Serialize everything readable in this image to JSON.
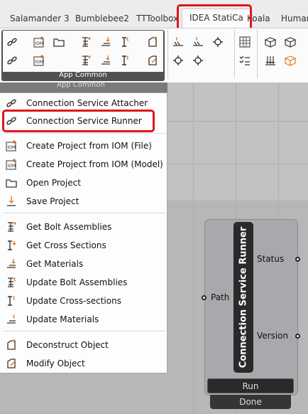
{
  "tabs": [
    "Salamander 3",
    "Bumblebee2",
    "TTToolbox",
    "IDEA StatiCa",
    "Koala",
    "Human"
  ],
  "active_tab": "IDEA StatiCa",
  "ribbon": {
    "group_title": "App Common",
    "group_title_ghost": "App Common"
  },
  "menu": {
    "items": [
      {
        "label": "Connection Service Attacher",
        "icon": "chain-link-icon"
      },
      {
        "label": "Connection Service Runner",
        "icon": "chain-link-run-icon"
      },
      {
        "label": "Create Project from IOM (File)",
        "icon": "iom-file-icon"
      },
      {
        "label": "Create Project from IOM (Model)",
        "icon": "iom-model-icon"
      },
      {
        "label": "Open Project",
        "icon": "folder-icon"
      },
      {
        "label": "Save Project",
        "icon": "save-arrow-icon"
      },
      {
        "label": "Get Bolt Assemblies",
        "icon": "bolt-assembly-icon"
      },
      {
        "label": "Get Cross Sections",
        "icon": "cross-section-icon"
      },
      {
        "label": "Get Materials",
        "icon": "material-icon"
      },
      {
        "label": "Update Bolt Assemblies",
        "icon": "bolt-update-icon"
      },
      {
        "label": "Update Cross-sections",
        "icon": "cross-section-update-icon"
      },
      {
        "label": "Update Materials",
        "icon": "material-update-icon"
      },
      {
        "label": "Deconstruct Object",
        "icon": "deconstruct-icon"
      },
      {
        "label": "Modify Object",
        "icon": "modify-icon"
      }
    ]
  },
  "node": {
    "title": "Connection Service Runner",
    "input": "Path",
    "outputs": [
      "Status",
      "Version"
    ],
    "run_label": "Run",
    "status_label": "Done"
  },
  "colors": {
    "highlight": "#e0151e",
    "accent_orange": "#e8751a"
  }
}
